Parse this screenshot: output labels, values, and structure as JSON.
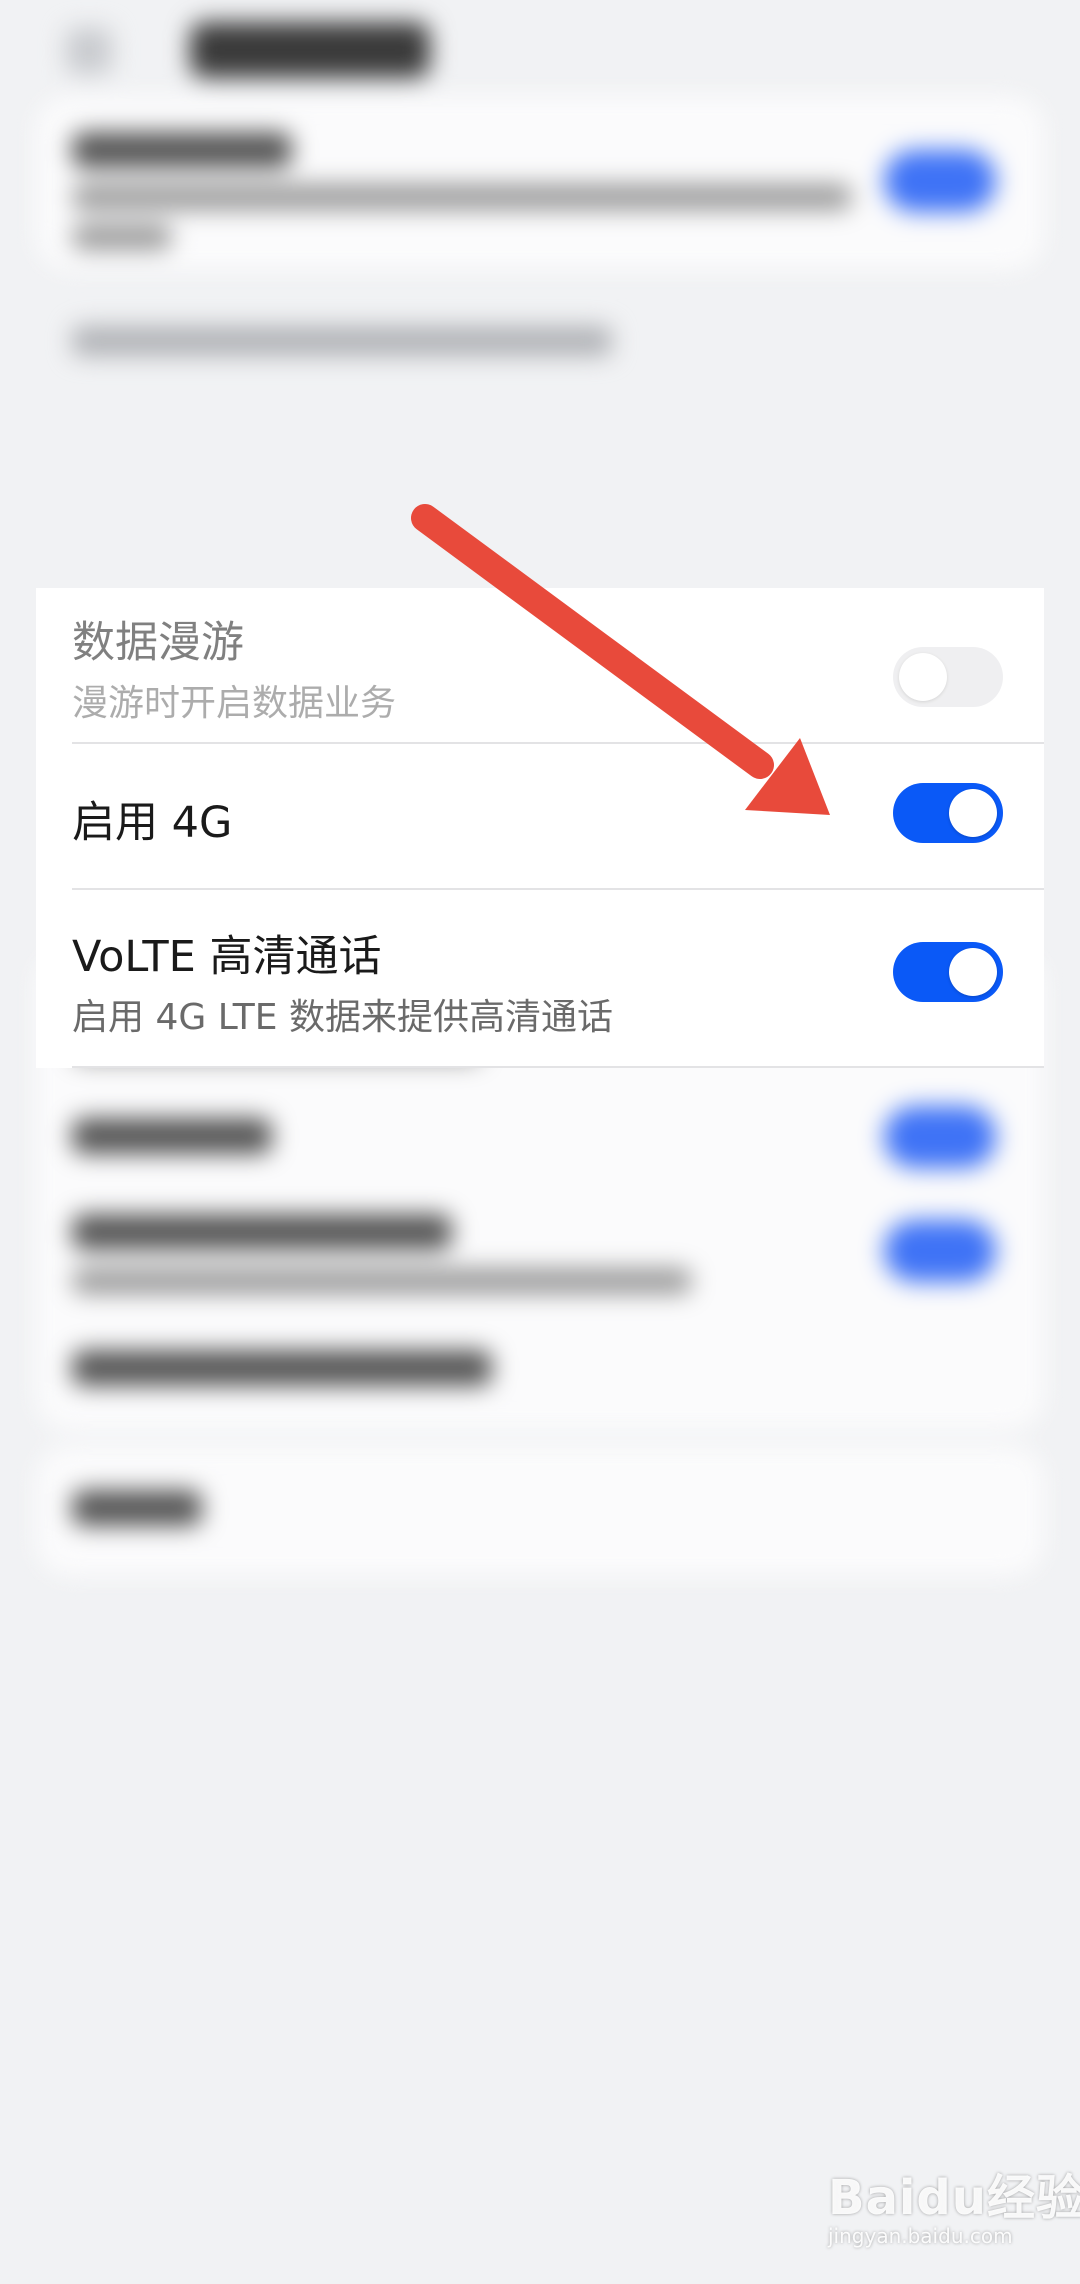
{
  "settings_card": {
    "data_roaming": {
      "title": "数据漫游",
      "subtitle": "漫游时开启数据业务",
      "enabled": false
    },
    "enable_4g": {
      "title": "启用 4G",
      "enabled": true
    },
    "volte": {
      "title": "VoLTE 高清通话",
      "subtitle": "启用 4G LTE 数据来提供高清通话",
      "enabled": true
    }
  },
  "annotation": {
    "arrow_color": "#e84a3b",
    "points_to": "enable_4g toggle"
  },
  "watermark": {
    "logo": "Baidu经验",
    "url": "jingyan.baidu.com"
  },
  "colors": {
    "toggle_on": "#0a59f7",
    "toggle_off": "#e6e6e8",
    "background": "#f1f2f4"
  }
}
